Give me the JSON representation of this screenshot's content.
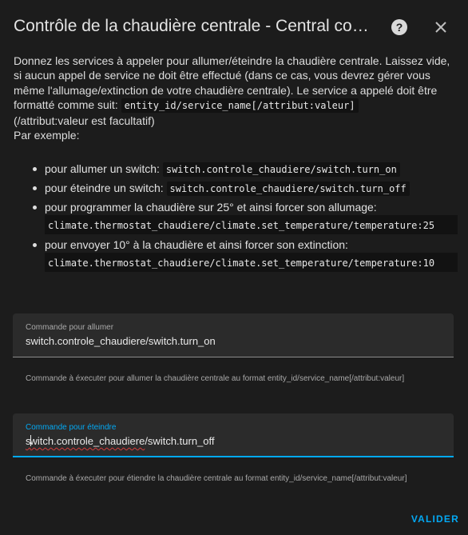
{
  "dialog": {
    "title": "Contrôle de la chaudière centrale - Central co…",
    "help_icon": "help-circle-icon",
    "close_icon": "close-icon"
  },
  "description": {
    "intro": "Donnez les services à appeler pour allumer/éteindre la chaudière centrale. Laissez vide, si aucun appel de service ne doit être effectué (dans ce cas, vous devrez gérer vous même l'allumage/extinction de votre chaudière centrale). Le service a appelé doit être formatté comme suit:",
    "format_code": "entity_id/service_name[/attribut:valeur]",
    "format_note": "(/attribut:valeur est facultatif)",
    "example_heading": "Par exemple:",
    "examples": [
      {
        "text": "pour allumer un switch:",
        "code": "switch.controle_chaudiere/switch.turn_on"
      },
      {
        "text": "pour éteindre un switch:",
        "code": "switch.controle_chaudiere/switch.turn_off"
      },
      {
        "text": "pour programmer la chaudière sur 25° et ainsi forcer son allumage:",
        "code": "climate.thermostat_chaudiere/climate.set_temperature/temperature:25"
      },
      {
        "text": "pour envoyer 10° à la chaudière et ainsi forcer son extinction:",
        "code": "climate.thermostat_chaudiere/climate.set_temperature/temperature:10"
      }
    ]
  },
  "fields": {
    "on": {
      "label": "Commande pour allumer",
      "value": "switch.controle_chaudiere/switch.turn_on",
      "helper": "Commande à éxecuter pour allumer la chaudière centrale au format entity_id/service_name[/attribut:valeur]"
    },
    "off": {
      "label": "Commande pour éteindre",
      "value_first": "s",
      "value_rest": "witch.controle_chaudiere",
      "value_tail": "/switch.turn_off",
      "helper": "Commande à éxecuter pour étiendre la chaudière centrale au format entity_id/service_name[/attribut:valeur]"
    }
  },
  "actions": {
    "submit_label": "VALIDER"
  },
  "colors": {
    "accent": "#03a9f4",
    "background": "#1c1c1c",
    "field_background": "#2b2b2b",
    "spellcheck": "#d43c3c"
  }
}
